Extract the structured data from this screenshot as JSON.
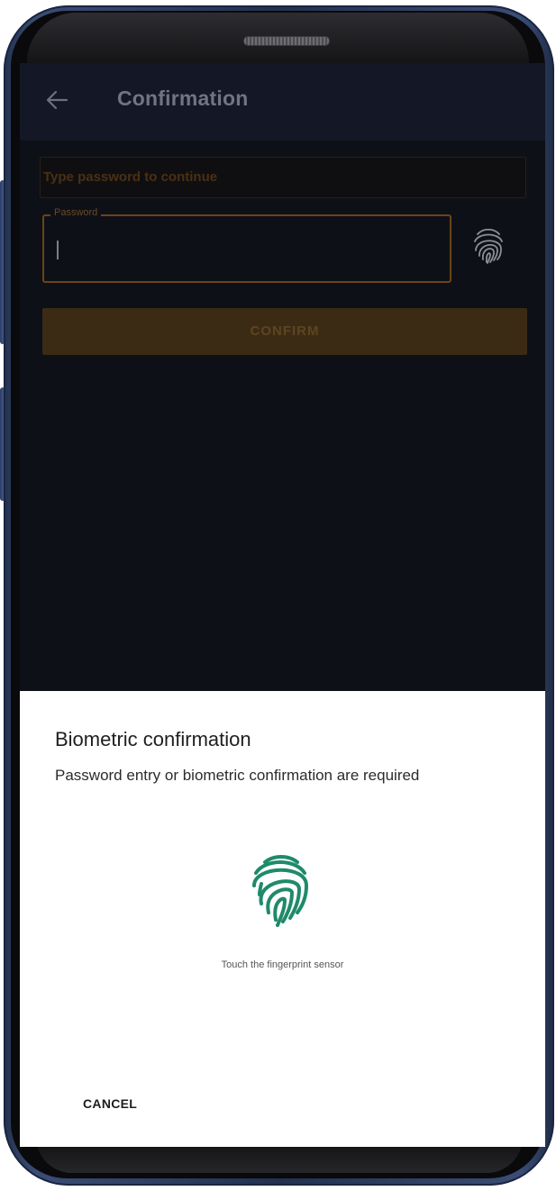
{
  "app_bar": {
    "title": "Confirmation"
  },
  "form": {
    "instruction": "Type password to continue",
    "password_label": "Password",
    "password_value": "",
    "confirm_label": "CONFIRM"
  },
  "biometric_sheet": {
    "title": "Biometric confirmation",
    "subtitle": "Password entry or biometric confirmation are required",
    "sensor_hint": "Touch the fingerprint sensor",
    "cancel_label": "CANCEL"
  },
  "icons": {
    "back": "back-arrow-icon",
    "fingerprint_small": "fingerprint-icon",
    "fingerprint_large": "fingerprint-icon"
  },
  "colors": {
    "screen_background": "#0e1017",
    "accent_orange": "#6b4416",
    "fingerprint_green": "#1f8a6a",
    "sheet_background": "#ffffff"
  }
}
